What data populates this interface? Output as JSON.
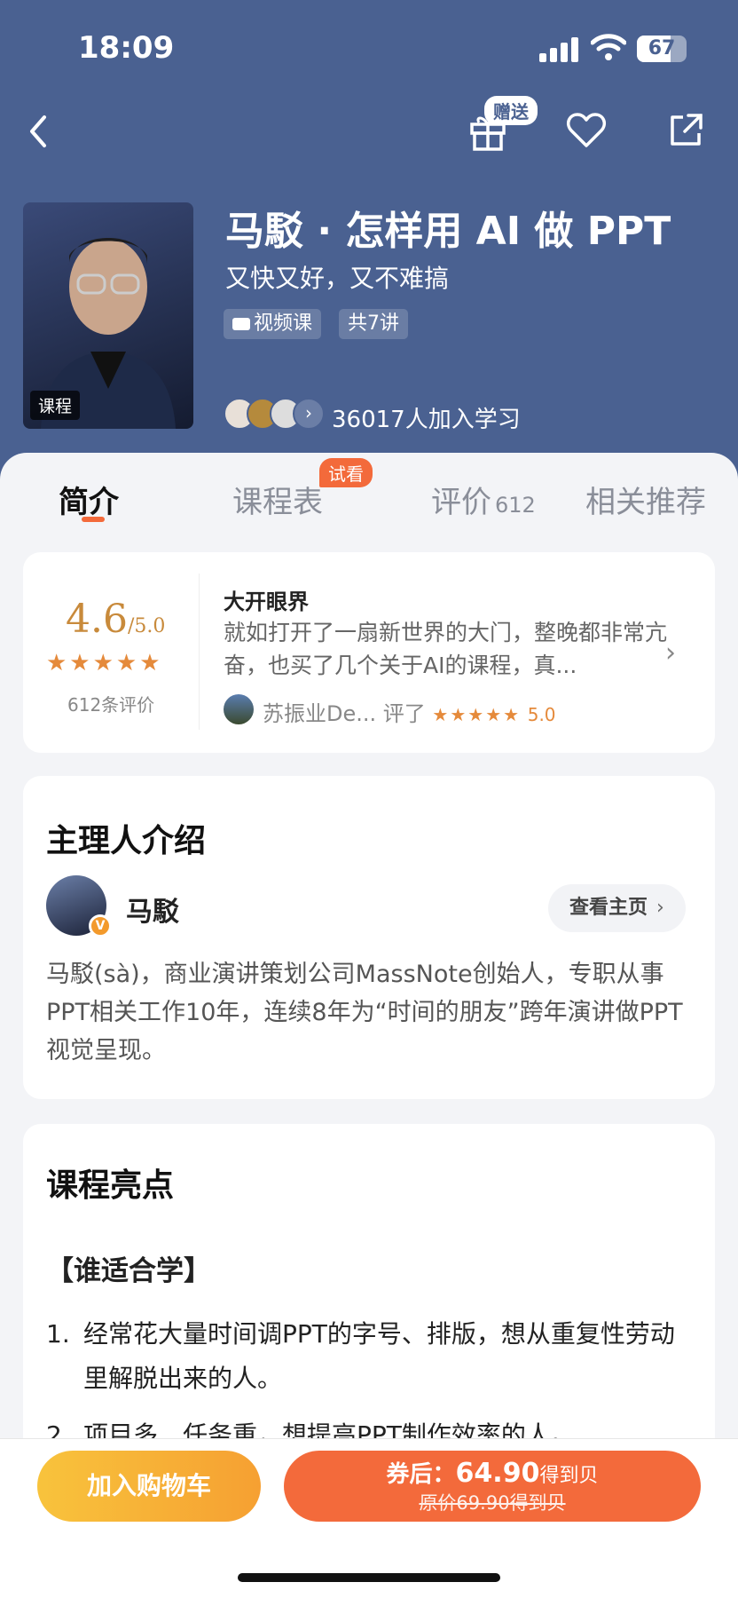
{
  "status_bar": {
    "time": "18:09",
    "battery": "67",
    "battery_level": 0.67
  },
  "nav": {
    "gift_badge": "赠送"
  },
  "course": {
    "cover_tag": "课程",
    "title": "马駁 · 怎样用 AI 做 PPT",
    "subtitle": "又快又好，又不难搞",
    "tag_video": "视频课",
    "tag_lectures": "共7讲",
    "learners_text": "36017人加入学习"
  },
  "tabs": {
    "intro": "简介",
    "schedule": "课程表",
    "trial_badge": "试看",
    "reviews": "评价",
    "reviews_count": "612",
    "related": "相关推荐"
  },
  "rating": {
    "score": "4.6",
    "out_of": "/5.0",
    "count_text": "612条评价",
    "stars": 4.6,
    "review_title": "大开眼界",
    "review_body": "就如打开了一扇新世界的大门，整晚都非常亢奋，也买了几个关于AI的课程，真...",
    "reviewer": "苏振业De...",
    "reviewed_label": "评了",
    "reviewer_score": "5.0"
  },
  "host": {
    "section_title": "主理人介绍",
    "name": "马駁",
    "homepage_button": "查看主页",
    "bio": "马駁(sà)，商业演讲策划公司MassNote创始人，专职从事PPT相关工作10年，连续8年为“时间的朋友”跨年演讲做PPT视觉呈现。"
  },
  "highlights": {
    "section_title": "课程亮点",
    "subheading": "【谁适合学】",
    "items": [
      {
        "num": "1.",
        "text": "经常花大量时间调PPT的字号、排版，想从重复性劳动里解脱出来的人。"
      },
      {
        "num": "2.",
        "text": "项目多、任务重，想提高PPT制作效率的人。"
      }
    ]
  },
  "bottom_bar": {
    "cart_button": "加入购物车",
    "coupon_label": "券后：",
    "coupon_price": "64.90",
    "coupon_unit": "得到贝",
    "original_price": "原价69.90得到贝"
  },
  "colors": {
    "brand": "#4a6191",
    "accent": "#f36a3b",
    "gold": "#c88a3b",
    "star": "#e58a3b"
  }
}
